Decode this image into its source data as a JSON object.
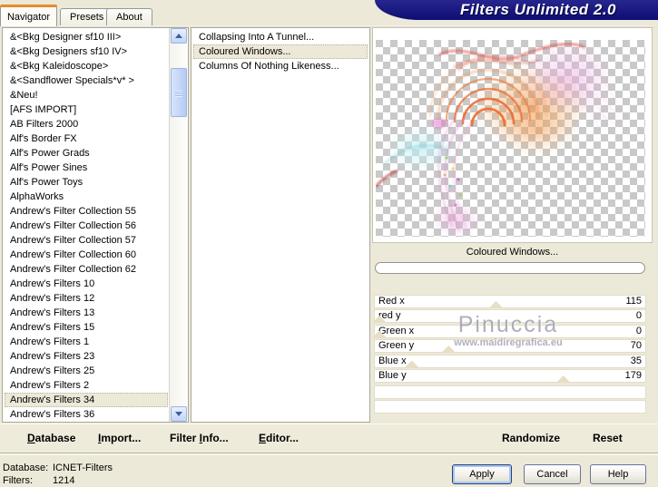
{
  "window": {
    "title": "Filters Unlimited 2.0"
  },
  "tabs": {
    "navigator": "Navigator",
    "presets": "Presets",
    "about": "About"
  },
  "category_list": {
    "items": [
      "&<Bkg Designer sf10 III>",
      "&<Bkg Designers sf10 IV>",
      "&<Bkg Kaleidoscope>",
      "&<Sandflower Specials*v* >",
      "&Neu!",
      "[AFS IMPORT]",
      "AB Filters 2000",
      "Alf's Border FX",
      "Alf's Power Grads",
      "Alf's Power Sines",
      "Alf's Power Toys",
      "AlphaWorks",
      "Andrew's Filter Collection 55",
      "Andrew's Filter Collection 56",
      "Andrew's Filter Collection 57",
      "Andrew's Filter Collection 60",
      "Andrew's Filter Collection 62",
      "Andrew's Filters 10",
      "Andrew's Filters 12",
      "Andrew's Filters 13",
      "Andrew's Filters 15",
      "Andrew's Filters 1",
      "Andrew's Filters 23",
      "Andrew's Filters 25",
      "Andrew's Filters 2",
      "Andrew's Filters 34",
      "Andrew's Filters 36"
    ],
    "selected": "Andrew's Filters 34"
  },
  "filter_list": {
    "items": [
      "Collapsing Into A Tunnel...",
      "Coloured Windows...",
      "Columns Of Nothing Likeness..."
    ],
    "selected": "Coloured Windows..."
  },
  "filter_panel": {
    "name": "Coloured Windows...",
    "progress_percent": 0
  },
  "sliders": {
    "max": 255,
    "items": [
      {
        "label": "Red x",
        "value": 115
      },
      {
        "label": "red y",
        "value": 0
      },
      {
        "label": "Green x",
        "value": 0
      },
      {
        "label": "Green y",
        "value": 70
      },
      {
        "label": "Blue x",
        "value": 35
      },
      {
        "label": "Blue y",
        "value": 179
      }
    ]
  },
  "watermark": {
    "name": "Pinuccia",
    "site": "www.maidiregrafica.eu"
  },
  "toolbar": {
    "database": {
      "pre": "",
      "key": "D",
      "post": "atabase"
    },
    "import": {
      "pre": "",
      "key": "I",
      "post": "mport..."
    },
    "filter_info": {
      "pre": "Filter ",
      "key": "I",
      "post": "nfo..."
    },
    "editor": {
      "pre": "",
      "key": "E",
      "post": "ditor..."
    },
    "randomize": {
      "pre": "Randomize",
      "key": "",
      "post": ""
    },
    "reset": {
      "pre": "Reset",
      "key": "",
      "post": ""
    }
  },
  "status": {
    "database_label": "Database:",
    "database_value": "ICNET-Filters",
    "filters_label": "Filters:",
    "filters_value": "1214"
  },
  "buttons": {
    "apply": "Apply",
    "cancel": "Cancel",
    "help": "Help"
  },
  "colors": {
    "accent_orange": "#e68b2c",
    "title_navy": "#10107a",
    "selection_bg": "#ece9d8",
    "checker_gray": "#c9c9c9"
  }
}
